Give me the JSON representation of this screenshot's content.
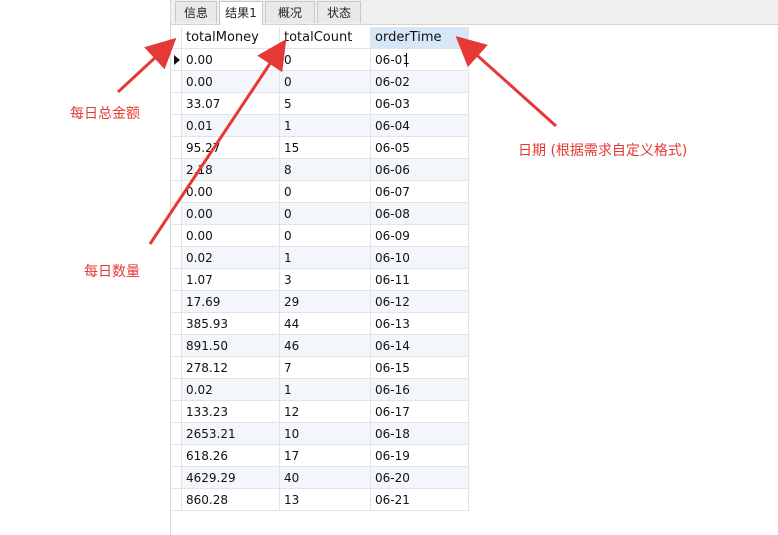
{
  "tabs": [
    {
      "label": "信息",
      "active": false
    },
    {
      "label": "结果1",
      "active": true
    },
    {
      "label": "概况",
      "active": false
    },
    {
      "label": "状态",
      "active": false
    }
  ],
  "columns": [
    "totalMoney",
    "totalCount",
    "orderTime"
  ],
  "rows": [
    [
      "0.00",
      "0",
      "06-01"
    ],
    [
      "0.00",
      "0",
      "06-02"
    ],
    [
      "33.07",
      "5",
      "06-03"
    ],
    [
      "0.01",
      "1",
      "06-04"
    ],
    [
      "95.27",
      "15",
      "06-05"
    ],
    [
      "2.18",
      "8",
      "06-06"
    ],
    [
      "0.00",
      "0",
      "06-07"
    ],
    [
      "0.00",
      "0",
      "06-08"
    ],
    [
      "0.00",
      "0",
      "06-09"
    ],
    [
      "0.02",
      "1",
      "06-10"
    ],
    [
      "1.07",
      "3",
      "06-11"
    ],
    [
      "17.69",
      "29",
      "06-12"
    ],
    [
      "385.93",
      "44",
      "06-13"
    ],
    [
      "891.50",
      "46",
      "06-14"
    ],
    [
      "278.12",
      "7",
      "06-15"
    ],
    [
      "0.02",
      "1",
      "06-16"
    ],
    [
      "133.23",
      "12",
      "06-17"
    ],
    [
      "2653.21",
      "10",
      "06-18"
    ],
    [
      "618.26",
      "17",
      "06-19"
    ],
    [
      "4629.29",
      "40",
      "06-20"
    ],
    [
      "860.28",
      "13",
      "06-21"
    ]
  ],
  "annotations": {
    "total_money": "每日总金额",
    "total_count": "每日数量",
    "order_time": "日期 (根据需求自定义格式)"
  },
  "colors": {
    "annotation": "#e53935",
    "selected_header": "#d6e8f7",
    "alt_row": "#f3f7fb"
  }
}
